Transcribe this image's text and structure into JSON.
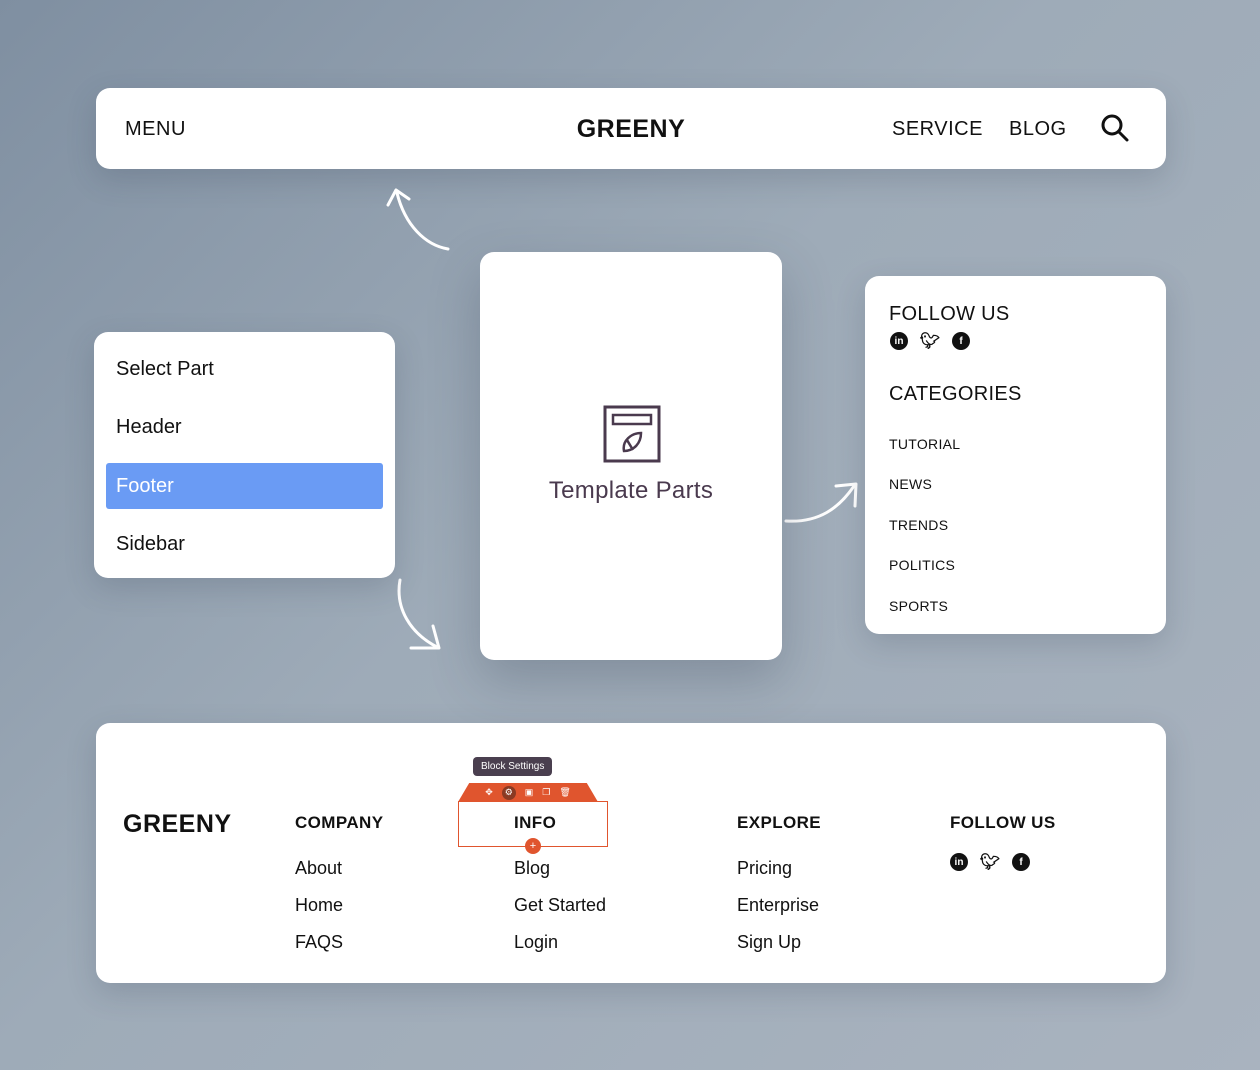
{
  "header": {
    "menu": "MENU",
    "logo": "GREENY",
    "nav": [
      "SERVICE",
      "BLOG"
    ]
  },
  "select_part": {
    "title": "Select Part",
    "options": [
      "Header",
      "Footer",
      "Sidebar"
    ],
    "selected": "Footer"
  },
  "template": {
    "label": "Template Parts"
  },
  "sidebar": {
    "follow_title": "FOLLOW US",
    "categories_title": "CATEGORIES",
    "categories": [
      "TUTORIAL",
      "NEWS",
      "TRENDS",
      "POLITICS",
      "SPORTS"
    ]
  },
  "footer": {
    "logo": "GREENY",
    "columns": [
      {
        "heading": "COMPANY",
        "links": [
          "About",
          "Home",
          "FAQS"
        ]
      },
      {
        "heading": "INFO",
        "links": [
          "Blog",
          "Get Started",
          "Login"
        ]
      },
      {
        "heading": "EXPLORE",
        "links": [
          "Pricing",
          "Enterprise",
          "Sign Up"
        ]
      }
    ],
    "follow_title": "FOLLOW US",
    "tooltip": "Block Settings"
  },
  "colors": {
    "accent_blue": "#6a9bf4",
    "block_orange": "#e0552e",
    "template_text": "#4a3a4e"
  }
}
